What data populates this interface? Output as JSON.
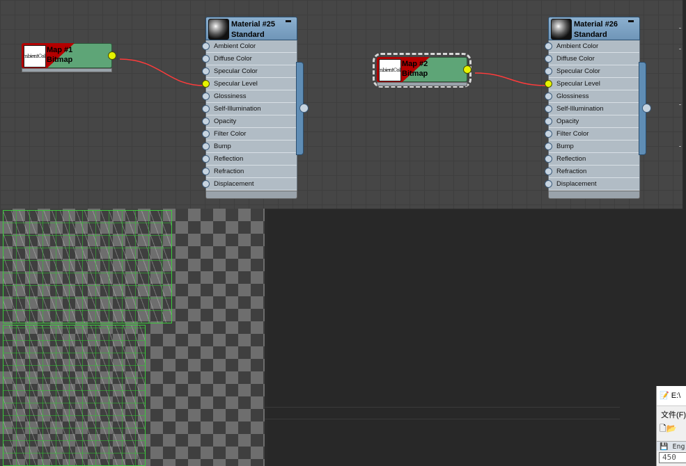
{
  "graph": {
    "map_nodes": [
      {
        "title": "Map #1",
        "subtitle": "Bitmap",
        "thumb_text": "AmbientColor",
        "selected": false
      },
      {
        "title": "Map #2",
        "subtitle": "Bitmap",
        "thumb_text": "AmbientColor",
        "selected": true
      }
    ],
    "material_nodes": [
      {
        "title": "Material #25",
        "subtitle": "Standard",
        "slots": [
          "Ambient Color",
          "Diffuse Color",
          "Specular Color",
          "Specular Level",
          "Glossiness",
          "Self-Illumination",
          "Opacity",
          "Filter Color",
          "Bump",
          "Reflection",
          "Refraction",
          "Displacement"
        ],
        "connected_slot": "Specular Level"
      },
      {
        "title": "Material #26",
        "subtitle": "Standard",
        "slots": [
          "Ambient Color",
          "Diffuse Color",
          "Specular Color",
          "Specular Level",
          "Glossiness",
          "Self-Illumination",
          "Opacity",
          "Filter Color",
          "Bump",
          "Reflection",
          "Refraction",
          "Displacement"
        ],
        "connected_slot": "Specular Level"
      }
    ],
    "colors": {
      "wire": "#ff3b3b",
      "socket_connected": "#e6f400",
      "material_header": "#7aa0c4",
      "map_body": "#5ea577",
      "map_red": "#b40000"
    }
  },
  "notepad": {
    "title": "E:\\",
    "menu": "文件(F)",
    "encoding": "Eng",
    "field_value": "450"
  }
}
